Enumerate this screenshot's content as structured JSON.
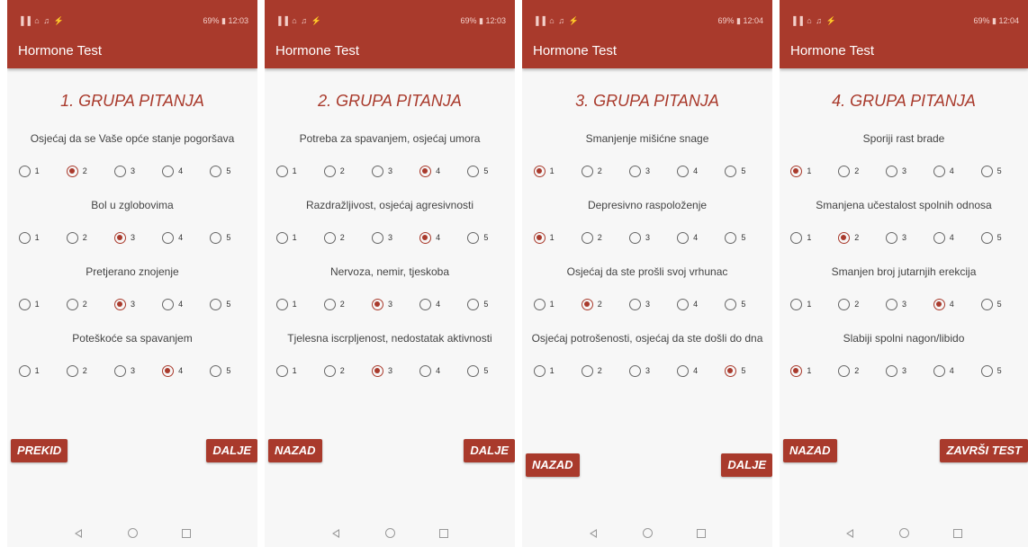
{
  "status_left": "▐▐ ⌂ ♫ ⚡",
  "status_right_1": "69% ▮ 12:03",
  "status_right_2": "69% ▮ 12:03",
  "status_right_3": "69% ▮ 12:04",
  "status_right_4": "69% ▮ 12:04",
  "app_title": "Hormone Test",
  "option_labels": [
    "1",
    "2",
    "3",
    "4",
    "5"
  ],
  "screens": [
    {
      "title": "1. GRUPA PITANJA",
      "questions": [
        {
          "text": "Osjećaj da se Vaše opće stanje pogoršava",
          "selected": 2
        },
        {
          "text": "Bol u zglobovima",
          "selected": 3
        },
        {
          "text": "Pretjerano znojenje",
          "selected": 3
        },
        {
          "text": "Poteškoće sa spavanjem",
          "selected": 4
        }
      ],
      "left_button": "PREKID",
      "right_button": "DALJE"
    },
    {
      "title": "2. GRUPA PITANJA",
      "questions": [
        {
          "text": "Potreba za spavanjem, osjećaj umora",
          "selected": 4
        },
        {
          "text": "Razdražljivost, osjećaj agresivnosti",
          "selected": 4
        },
        {
          "text": "Nervoza, nemir, tjeskoba",
          "selected": 3
        },
        {
          "text": "Tjelesna iscrpljenost, nedostatak aktivnosti",
          "selected": 3
        }
      ],
      "left_button": "NAZAD",
      "right_button": "DALJE"
    },
    {
      "title": "3. GRUPA PITANJA",
      "questions": [
        {
          "text": "Smanjenje mišićne snage",
          "selected": 1
        },
        {
          "text": "Depresivno raspoloženje",
          "selected": 1
        },
        {
          "text": "Osjećaj da ste prošli svoj vrhunac",
          "selected": 2
        },
        {
          "text": "Osjećaj potrošenosti, osjećaj da ste došli do dna",
          "selected": 5
        }
      ],
      "left_button": "NAZAD",
      "right_button": "DALJE"
    },
    {
      "title": "4. GRUPA PITANJA",
      "questions": [
        {
          "text": "Sporiji rast brade",
          "selected": 1
        },
        {
          "text": "Smanjena učestalost spolnih odnosa",
          "selected": 2
        },
        {
          "text": "Smanjen broj jutarnjih erekcija",
          "selected": 4
        },
        {
          "text": "Slabiji spolni nagon/libido",
          "selected": 1
        }
      ],
      "left_button": "NAZAD",
      "right_button": "ZAVRŠI TEST"
    }
  ]
}
